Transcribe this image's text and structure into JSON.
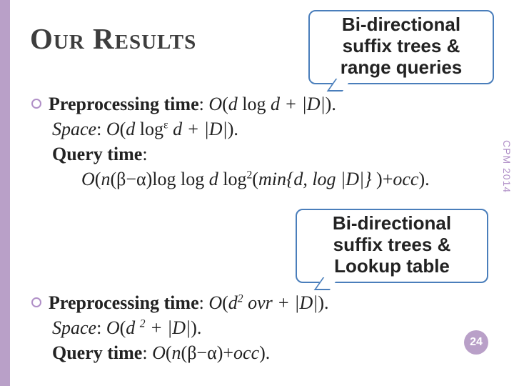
{
  "title": "Our Results",
  "sidetext": "CPM 2014",
  "page_number": "24",
  "callouts": {
    "top": {
      "l1": "Bi-directional",
      "l2": "suffix trees &",
      "l3": "range queries"
    },
    "bottom": {
      "l1": "Bi-directional",
      "l2": "suffix trees &",
      "l3": "Lookup table"
    }
  },
  "blocks": {
    "a": {
      "preproc_label": "Preprocessing time",
      "preproc_val_pre": ": ",
      "preproc_expr_a": "O",
      "preproc_expr_b": "(",
      "preproc_expr_c": "d",
      "preproc_expr_d": " log ",
      "preproc_expr_e": "d + |D|",
      "preproc_expr_f": ").",
      "space_label": "Space",
      "space_val_pre": ": ",
      "space_a": "O",
      "space_b": "(",
      "space_c": "d",
      "space_d": " log",
      "space_eps": "ε",
      "space_e": " d + |D|",
      "space_f": ").",
      "query_label": "Query time",
      "query_colon": ":",
      "query_a": "O",
      "query_b": "(",
      "query_c": "n",
      "query_d": "(β−α)log log ",
      "query_e": "d",
      "query_f": " log",
      "query_sup2": "2",
      "query_g": "(",
      "query_h": "min{d, log |D|}",
      "query_i": " )+",
      "query_j": "occ",
      "query_k": ")."
    },
    "b": {
      "preproc_label": "Preprocessing time",
      "preproc_val_pre": ": ",
      "preproc_a": "O",
      "preproc_b": "(",
      "preproc_c": "d",
      "preproc_sup2": "2",
      "preproc_d": " ovr + |D|",
      "preproc_e": ").",
      "space_label": "Space",
      "space_val_pre": ": ",
      "space_a": "O",
      "space_b": "(",
      "space_c": "d ",
      "space_sup2": "2",
      "space_d": " + |D|",
      "space_e": ").",
      "query_label": "Query time",
      "query_val_pre": ": ",
      "query_a": "O",
      "query_b": "(",
      "query_c": "n",
      "query_d": "(β−α)+",
      "query_e": "occ",
      "query_f": ")."
    }
  }
}
